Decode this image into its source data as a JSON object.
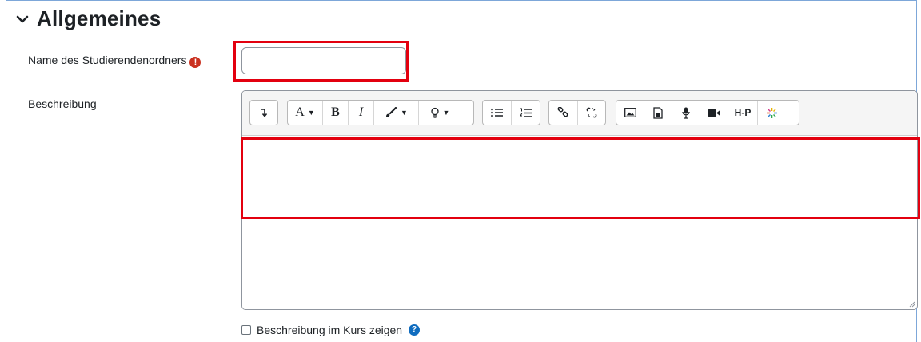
{
  "section": {
    "title": "Allgemeines",
    "icon": "chevron-down-icon"
  },
  "name_field": {
    "label": "Name des Studierendenordners",
    "required_icon": "!",
    "value": "",
    "placeholder": ""
  },
  "description": {
    "label": "Beschreibung",
    "toolbar": {
      "groups": [
        [
          "show-more-icon"
        ],
        [
          "font-size-icon",
          "bold-icon",
          "italic-icon",
          "brush-color-icon",
          "lightbulb-icon"
        ],
        [
          "bullet-list-icon",
          "numbered-list-icon"
        ],
        [
          "link-icon",
          "unlink-icon"
        ],
        [
          "image-icon",
          "media-file-icon",
          "microphone-icon",
          "video-icon",
          "h5p-icon",
          "sparkle-icon"
        ]
      ],
      "bold_label": "B",
      "italic_label": "I",
      "font_label": "A",
      "h5p_label": "H-P"
    },
    "content": ""
  },
  "show_description": {
    "label": "Beschreibung im Kurs zeigen",
    "checked": false,
    "help_icon": "?"
  },
  "colors": {
    "highlight": "#e3000f",
    "required": "#ca3120",
    "help": "#0f6cbf"
  }
}
